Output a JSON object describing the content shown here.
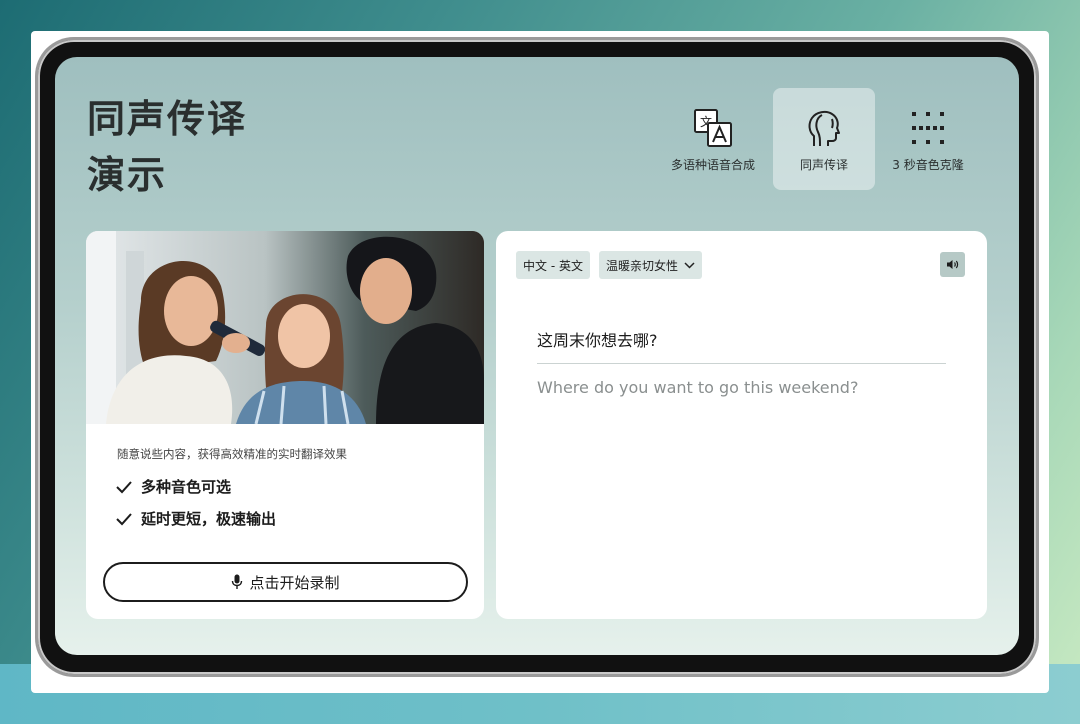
{
  "title": {
    "line1": "同声传译",
    "line2": "演示"
  },
  "tabs": [
    {
      "label": "多语种语音合成",
      "icon": "translate-icon",
      "active": false
    },
    {
      "label": "同声传译",
      "icon": "speaking-head-icon",
      "active": true
    },
    {
      "label": "3 秒音色克隆",
      "icon": "dot-grid-icon",
      "active": false
    }
  ],
  "left_card": {
    "description": "随意说些内容，获得高效精准的实时翻译效果",
    "features": [
      "多种音色可选",
      "延时更短，极速输出"
    ],
    "record_button": "点击开始录制"
  },
  "right_card": {
    "language_pair": "中文 - 英文",
    "voice": "温暖亲切女性",
    "source_text": "这周末你想去哪?",
    "target_text": "Where do you want to go this weekend?"
  }
}
